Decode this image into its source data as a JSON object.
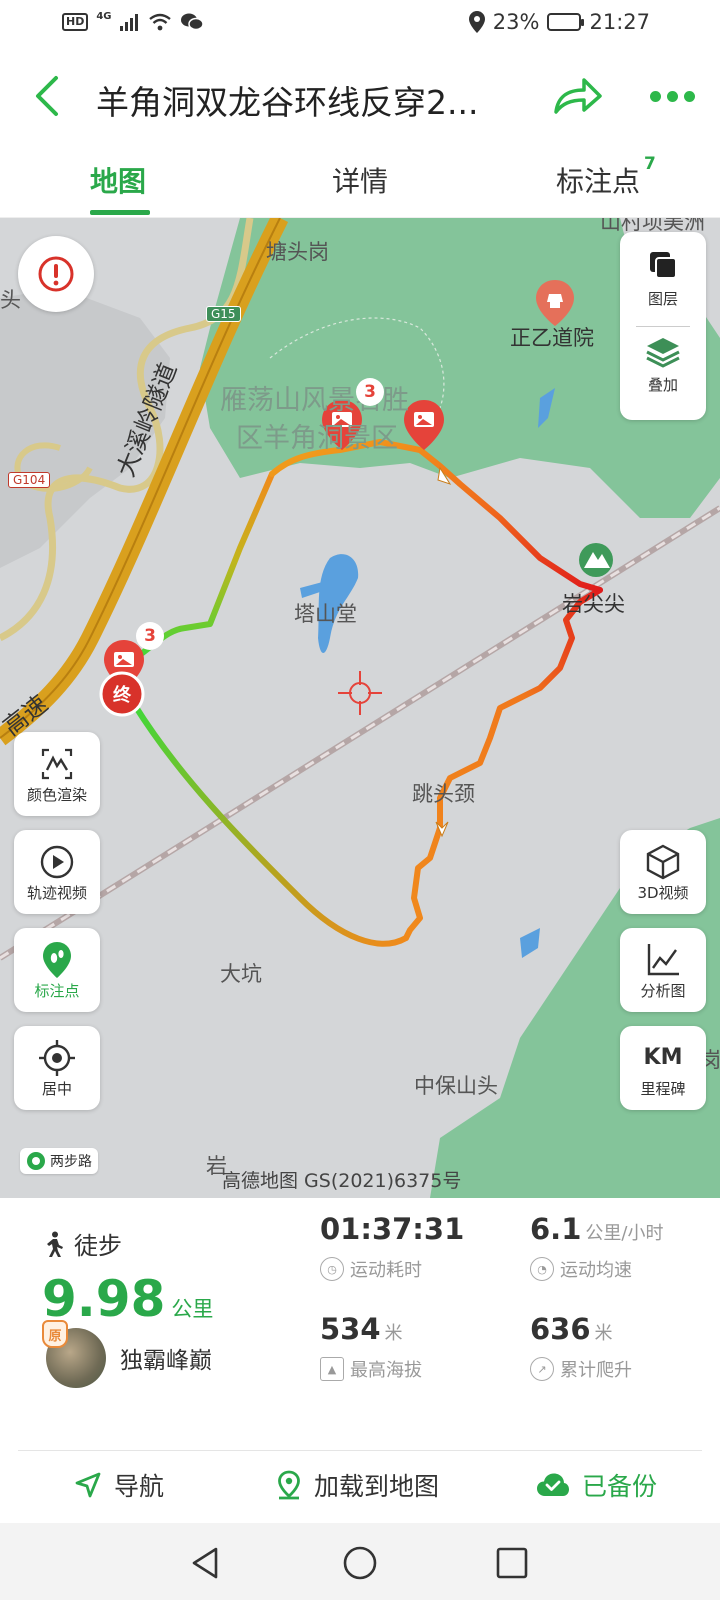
{
  "status_bar": {
    "network": "4G",
    "hd_label": "HD",
    "battery": "23%",
    "time": "21:27"
  },
  "header": {
    "title": "羊角洞双龙谷环线反穿2...",
    "tabs": [
      {
        "label": "地图",
        "active": true
      },
      {
        "label": "详情",
        "active": false
      },
      {
        "label": "标注点",
        "active": false,
        "badge": "7"
      }
    ]
  },
  "map": {
    "labels": {
      "tangtougang": "塘头岗",
      "zhengyi": "正乙道院",
      "scenic_1": "雁荡山风景名胜",
      "scenic_2": "区羊角洞景区",
      "tunnel": "大溪岭隧道",
      "tashantang": "塔山堂",
      "yanjianjian": "岩尖尖",
      "tiaotoujing": "跳头颈",
      "dakeng": "大坑",
      "zhongbao": "中保山头",
      "highway": "高速",
      "edge_tou": "头",
      "edge_shan": "山村坝美洲",
      "edge_yan": "岩",
      "edge_gang": "岗"
    },
    "road_chips": {
      "g15": "G15",
      "g104": "G104"
    },
    "photo_clusters": [
      "3",
      "3"
    ],
    "end_marker": "终",
    "layers_panel": {
      "layers": "图层",
      "overlay": "叠加"
    },
    "left_tools": [
      {
        "label": "颜色渲染",
        "icon": "color-render-icon"
      },
      {
        "label": "轨迹视频",
        "icon": "play-icon"
      },
      {
        "label": "标注点",
        "icon": "footprint-pin-icon"
      },
      {
        "label": "居中",
        "icon": "locate-icon"
      }
    ],
    "right_tools": [
      {
        "label": "3D视频",
        "icon": "cube-icon"
      },
      {
        "label": "分析图",
        "icon": "line-chart-icon"
      },
      {
        "label": "里程碑",
        "icon_text": "KM"
      }
    ],
    "brand": "两步路",
    "copyright": "高德地图 GS(2021)6375号"
  },
  "stats": {
    "sport_type": "徒步",
    "distance": {
      "value": "9.98",
      "unit": "公里"
    },
    "author": {
      "badge": "原",
      "name": "独霸峰巅"
    },
    "duration": {
      "value": "01:37:31",
      "label": "运动耗时"
    },
    "avg_speed": {
      "value": "6.1",
      "unit": "公里/小时",
      "label": "运动均速"
    },
    "max_altitude": {
      "value": "534",
      "unit": "米",
      "label": "最高海拔"
    },
    "total_climb": {
      "value": "636",
      "unit": "米",
      "label": "累计爬升"
    }
  },
  "actions": {
    "navigate": "导航",
    "load_to_map": "加载到地图",
    "backed_up": "已备份"
  },
  "colors": {
    "accent": "#2aa84a",
    "track_start": "#3fd83a",
    "track_mid": "#f08a1c",
    "track_high": "#e01b1b",
    "pin": "#e5433a"
  }
}
